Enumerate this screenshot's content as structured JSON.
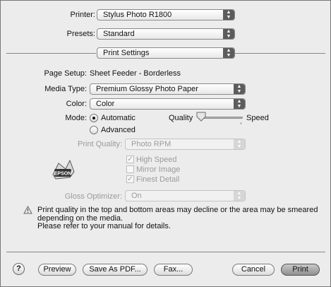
{
  "printer": {
    "label": "Printer:",
    "value": "Stylus Photo R1800"
  },
  "presets": {
    "label": "Presets:",
    "value": "Standard"
  },
  "panel": {
    "value": "Print Settings"
  },
  "page_setup": {
    "label": "Page Setup:",
    "value": "Sheet Feeder - Borderless"
  },
  "media_type": {
    "label": "Media Type:",
    "value": "Premium Glossy Photo Paper"
  },
  "color": {
    "label": "Color:",
    "value": "Color"
  },
  "mode": {
    "label": "Mode:",
    "automatic": "Automatic",
    "advanced": "Advanced",
    "selected": "Automatic"
  },
  "quality_slider": {
    "left_label": "Quality",
    "right_label": "Speed",
    "level": 0.0
  },
  "print_quality": {
    "label": "Print Quality:",
    "value": "Photo RPM"
  },
  "options": {
    "high_speed": {
      "label": "High Speed",
      "checked": true
    },
    "mirror_image": {
      "label": "Mirror Image",
      "checked": false
    },
    "finest_detail": {
      "label": "Finest Detail",
      "checked": true
    }
  },
  "gloss_optimizer": {
    "label": "Gloss Optimizer:",
    "value": "On"
  },
  "warning": {
    "line1": "Print quality in the top and bottom areas may decline or the area may be smeared",
    "line2": "depending on the media.",
    "line3": "Please refer to your manual for details."
  },
  "buttons": {
    "help": "?",
    "preview": "Preview",
    "save_pdf": "Save As PDF...",
    "fax": "Fax...",
    "cancel": "Cancel",
    "print": "Print"
  },
  "icons": {
    "arrows": "updown-arrows-icon",
    "warning": "warning-triangle-icon",
    "epson_logo": "epson-logo-icon"
  }
}
